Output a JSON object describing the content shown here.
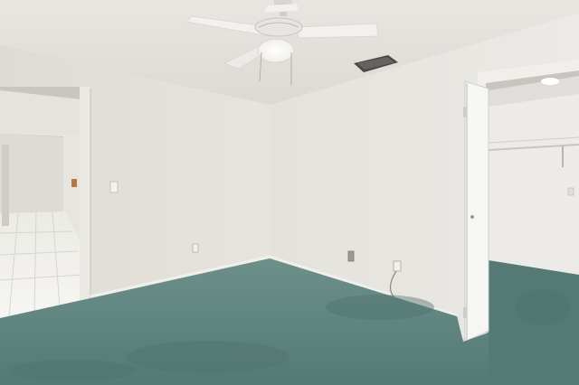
{
  "scene": {
    "kind": "photograph",
    "subject": "empty-bedroom-interior",
    "colors": {
      "ceiling": "#e6e4df",
      "wall_left": "#e1ded8",
      "wall_right": "#e9e7e2",
      "carpet": "#5f8480",
      "carpet_dark": "#4d706c",
      "hall_floor": "#f3f2ee",
      "door": "#f4f4f2",
      "closet_wall": "#ecebe8",
      "fan_blade": "#f2f1ee"
    },
    "features": [
      "ceiling-fan",
      "light-fixture",
      "ac-vent",
      "hallway-doorway",
      "closet-bifold-door",
      "closet-rod",
      "light-switch",
      "electrical-outlet",
      "carpet"
    ]
  }
}
